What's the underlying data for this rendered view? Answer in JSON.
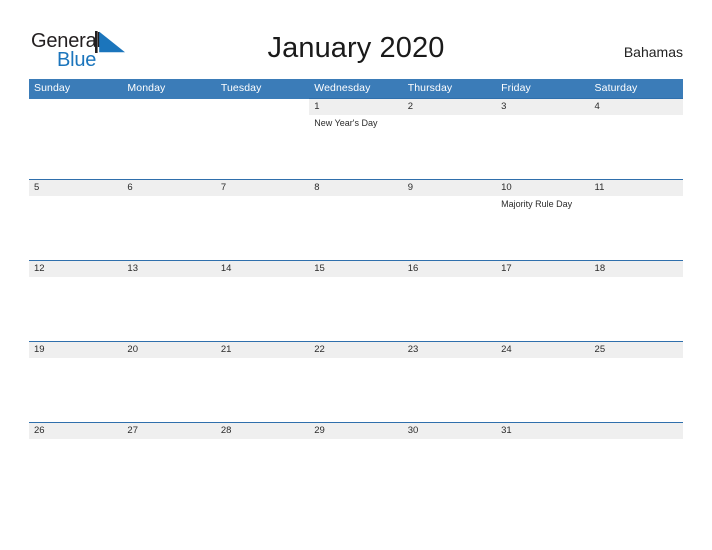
{
  "brand": {
    "name_top": "General",
    "name_bottom": "Blue",
    "sail_icon": "sail-triangle-icon",
    "color_dark": "#231f20",
    "color_blue": "#1b75bc"
  },
  "header": {
    "title": "January 2020",
    "country": "Bahamas"
  },
  "calendar": {
    "month": "January",
    "year": "2020",
    "accent_header_color": "#3b7cb8",
    "row_band_color": "#efefef",
    "row_border_color": "#2f6fac",
    "weekday_headers": [
      "Sunday",
      "Monday",
      "Tuesday",
      "Wednesday",
      "Thursday",
      "Friday",
      "Saturday"
    ],
    "weeks": [
      [
        {
          "date": "",
          "event": "",
          "filled": false
        },
        {
          "date": "",
          "event": "",
          "filled": false
        },
        {
          "date": "",
          "event": "",
          "filled": false
        },
        {
          "date": "1",
          "event": "New Year's Day",
          "filled": true
        },
        {
          "date": "2",
          "event": "",
          "filled": true
        },
        {
          "date": "3",
          "event": "",
          "filled": true
        },
        {
          "date": "4",
          "event": "",
          "filled": true
        }
      ],
      [
        {
          "date": "5",
          "event": "",
          "filled": true
        },
        {
          "date": "6",
          "event": "",
          "filled": true
        },
        {
          "date": "7",
          "event": "",
          "filled": true
        },
        {
          "date": "8",
          "event": "",
          "filled": true
        },
        {
          "date": "9",
          "event": "",
          "filled": true
        },
        {
          "date": "10",
          "event": "Majority Rule Day",
          "filled": true
        },
        {
          "date": "11",
          "event": "",
          "filled": true
        }
      ],
      [
        {
          "date": "12",
          "event": "",
          "filled": true
        },
        {
          "date": "13",
          "event": "",
          "filled": true
        },
        {
          "date": "14",
          "event": "",
          "filled": true
        },
        {
          "date": "15",
          "event": "",
          "filled": true
        },
        {
          "date": "16",
          "event": "",
          "filled": true
        },
        {
          "date": "17",
          "event": "",
          "filled": true
        },
        {
          "date": "18",
          "event": "",
          "filled": true
        }
      ],
      [
        {
          "date": "19",
          "event": "",
          "filled": true
        },
        {
          "date": "20",
          "event": "",
          "filled": true
        },
        {
          "date": "21",
          "event": "",
          "filled": true
        },
        {
          "date": "22",
          "event": "",
          "filled": true
        },
        {
          "date": "23",
          "event": "",
          "filled": true
        },
        {
          "date": "24",
          "event": "",
          "filled": true
        },
        {
          "date": "25",
          "event": "",
          "filled": true
        }
      ],
      [
        {
          "date": "26",
          "event": "",
          "filled": true
        },
        {
          "date": "27",
          "event": "",
          "filled": true
        },
        {
          "date": "28",
          "event": "",
          "filled": true
        },
        {
          "date": "29",
          "event": "",
          "filled": true
        },
        {
          "date": "30",
          "event": "",
          "filled": true
        },
        {
          "date": "31",
          "event": "",
          "filled": true
        },
        {
          "date": "",
          "event": "",
          "filled": true
        }
      ]
    ]
  }
}
